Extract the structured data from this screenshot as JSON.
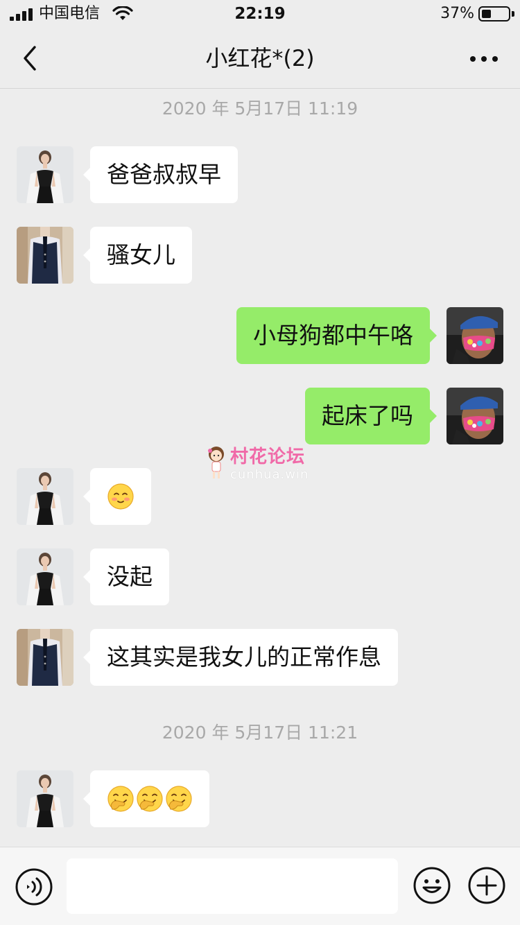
{
  "status_bar": {
    "carrier": "中国电信",
    "time": "22:19",
    "battery_percent": "37%",
    "battery_level": 0.37,
    "signal_bars": 4
  },
  "nav": {
    "title": "小红花*(2)"
  },
  "timestamps": [
    "2020 年 5月17日 11:19",
    "2020 年 5月17日 11:21"
  ],
  "messages": [
    {
      "side": "in",
      "sender": "woman-in-black-dress",
      "text": "爸爸叔叔早"
    },
    {
      "side": "in",
      "sender": "man-in-vest",
      "text": "骚女儿"
    },
    {
      "side": "out",
      "sender": "self-masked-man",
      "text": "小母狗都中午咯"
    },
    {
      "side": "out",
      "sender": "self-masked-man",
      "text": "起床了吗"
    },
    {
      "side": "in",
      "sender": "woman-in-black-dress",
      "text": "",
      "emoji": [
        "blushing-face"
      ]
    },
    {
      "side": "in",
      "sender": "woman-in-black-dress",
      "text": "没起"
    },
    {
      "side": "in",
      "sender": "man-in-vest",
      "text": "这其实是我女儿的正常作息"
    },
    {
      "side": "in",
      "sender": "woman-in-black-dress",
      "text": "",
      "emoji": [
        "facepalm-laugh",
        "facepalm-laugh",
        "facepalm-laugh"
      ]
    }
  ],
  "watermark": {
    "title": "村花论坛",
    "url": "cunhua.win"
  },
  "input": {
    "value": "",
    "placeholder": ""
  },
  "icons": {
    "back": "chevron-left-icon",
    "more": "more-dots-icon",
    "voice": "voice-icon",
    "emoji": "smiley-icon",
    "plus": "plus-icon"
  },
  "colors": {
    "background": "#ededed",
    "bubble_in": "#ffffff",
    "bubble_out": "#95ec69",
    "timestamp": "#a8a8a8",
    "watermark": "#f06aa8"
  }
}
